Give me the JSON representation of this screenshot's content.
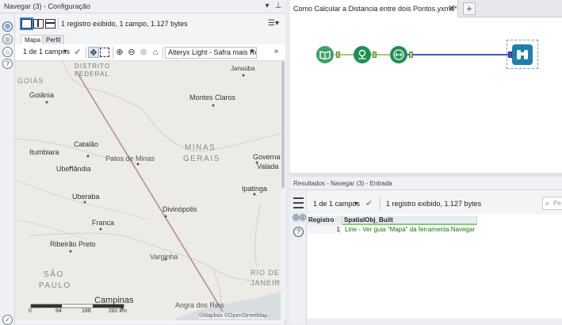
{
  "config_panel": {
    "title": "Navegar (3) - Configuração",
    "record_info": "1 registro exibido, 1 campo, 1.127 bytes",
    "tabs": [
      "Mapa",
      "Perfil"
    ],
    "field_select": "1 de 1 campos",
    "basemap": "Alteryx Light - Safra mais Rece"
  },
  "map": {
    "labels": {
      "distrito_federal_1": "DISTRITO",
      "distrito_federal_2": "FEDERAL",
      "goias": "GOIÁS",
      "goiania": "Goiânia",
      "janauba": "Janaúba",
      "montes_claros": "Montes Claros",
      "catalao": "Catalão",
      "itumbiara": "Itumbiara",
      "uberlandia": "Uberlândia",
      "patos_de_minas": "Patos de Minas",
      "minas_gerais_1": "MINAS",
      "minas_gerais_2": "GERAIS",
      "governador_valadares_1": "Governa",
      "governador_valadares_2": "Valada",
      "ipatinga": "Ipatinga",
      "uberaba": "Uberaba",
      "divinopolis": "Divinópolis",
      "franca": "Franca",
      "ribeirao_preto": "Ribeirão Preto",
      "varginha": "Varginha",
      "sao_paulo_1": "SÃO",
      "sao_paulo_2": "PAULO",
      "rio_de_janeiro_1": "RIO DE",
      "rio_de_janeiro_2": "JANEIRO",
      "campinas": "Campinas",
      "angra_dos_reis": "Angra dos Reis"
    },
    "scale": [
      "0",
      "94",
      "188",
      "282 km"
    ],
    "attribution": "©Mapbox ©OpenStreetMap"
  },
  "workflow": {
    "tab_title": "Como Calcular a Distancia entre dois Pontos.yxmd*",
    "tab_close": "✕",
    "tab_add": "+"
  },
  "results": {
    "title": "Resultados - Navegar (3) - Entrada",
    "field_select": "1 de 1 campos",
    "record_info": "1 registro exibido, 1.127 bytes",
    "search_placeholder": "Pe",
    "columns": [
      "Registro",
      "SpatialObj_Built"
    ],
    "rows": [
      {
        "registro": "1",
        "value": "Line - Ver guia \"Mapa\" da ferramenta Navegar"
      }
    ]
  },
  "colors": {
    "accent": "#3d7fd1",
    "route_line": "#b98d8d",
    "connection_line": "#4b4fc4",
    "input_tool": "#3fa06a",
    "spatial_tool": "#1f8f53",
    "browse_tool": "#1f7fa8"
  }
}
